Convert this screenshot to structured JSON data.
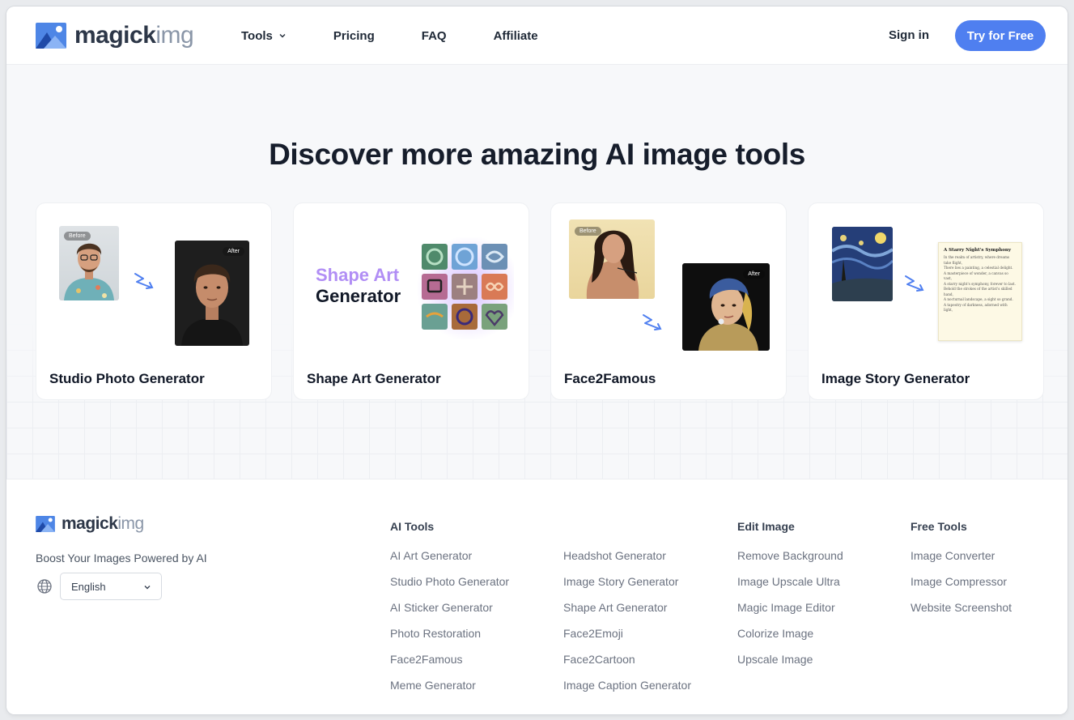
{
  "brand": {
    "name_part1": "magick",
    "name_part2": "img"
  },
  "nav": {
    "links": [
      {
        "label": "Tools",
        "has_dropdown": true
      },
      {
        "label": "Pricing"
      },
      {
        "label": "FAQ"
      },
      {
        "label": "Affiliate"
      }
    ],
    "signin_label": "Sign in",
    "cta_label": "Try for Free"
  },
  "hero": {
    "heading": "Discover more amazing AI image tools",
    "cards": [
      {
        "title": "Studio Photo Generator",
        "before_tag": "Before",
        "after_tag": "After"
      },
      {
        "title": "Shape Art Generator",
        "graphic_line1": "Shape Art",
        "graphic_line2": "Generator"
      },
      {
        "title": "Face2Famous",
        "before_tag": "Before",
        "after_tag": "After"
      },
      {
        "title": "Image Story Generator",
        "story_title": "A Starry Night's Symphony",
        "story_lines": [
          "In the realm of artistry, where dreams take flight,",
          "There lies a painting, a celestial delight.",
          "A masterpiece of wonder, a canvas so vast,",
          "A starry night's symphony, forever to last.",
          "Behold the strokes of the artist's skilled hand,",
          "A nocturnal landscape, a sight so grand.",
          "A tapestry of darkness, adorned with light,"
        ]
      }
    ]
  },
  "footer": {
    "tagline": "Boost Your Images Powered by AI",
    "language": "English",
    "columns": {
      "ai_tools_heading": "AI Tools",
      "ai_tools_a": [
        "AI Art Generator",
        "Studio Photo Generator",
        "AI Sticker Generator",
        "Photo Restoration",
        "Face2Famous",
        "Meme Generator"
      ],
      "ai_tools_b": [
        "Headshot Generator",
        "Image Story Generator",
        "Shape Art Generator",
        "Face2Emoji",
        "Face2Cartoon",
        "Image Caption Generator"
      ],
      "edit_heading": "Edit Image",
      "edit": [
        "Remove Background",
        "Image Upscale Ultra",
        "Magic Image Editor",
        "Colorize Image",
        "Upscale Image"
      ],
      "free_heading": "Free Tools",
      "free": [
        "Image Converter",
        "Image Compressor",
        "Website Screenshot"
      ]
    }
  },
  "colors": {
    "accent": "#4f7ff0",
    "heading": "#161d2b",
    "muted": "#6b7280"
  },
  "icons": [
    "logo-icon",
    "chevron-down-icon",
    "globe-icon",
    "squiggle-arrow-icon"
  ]
}
